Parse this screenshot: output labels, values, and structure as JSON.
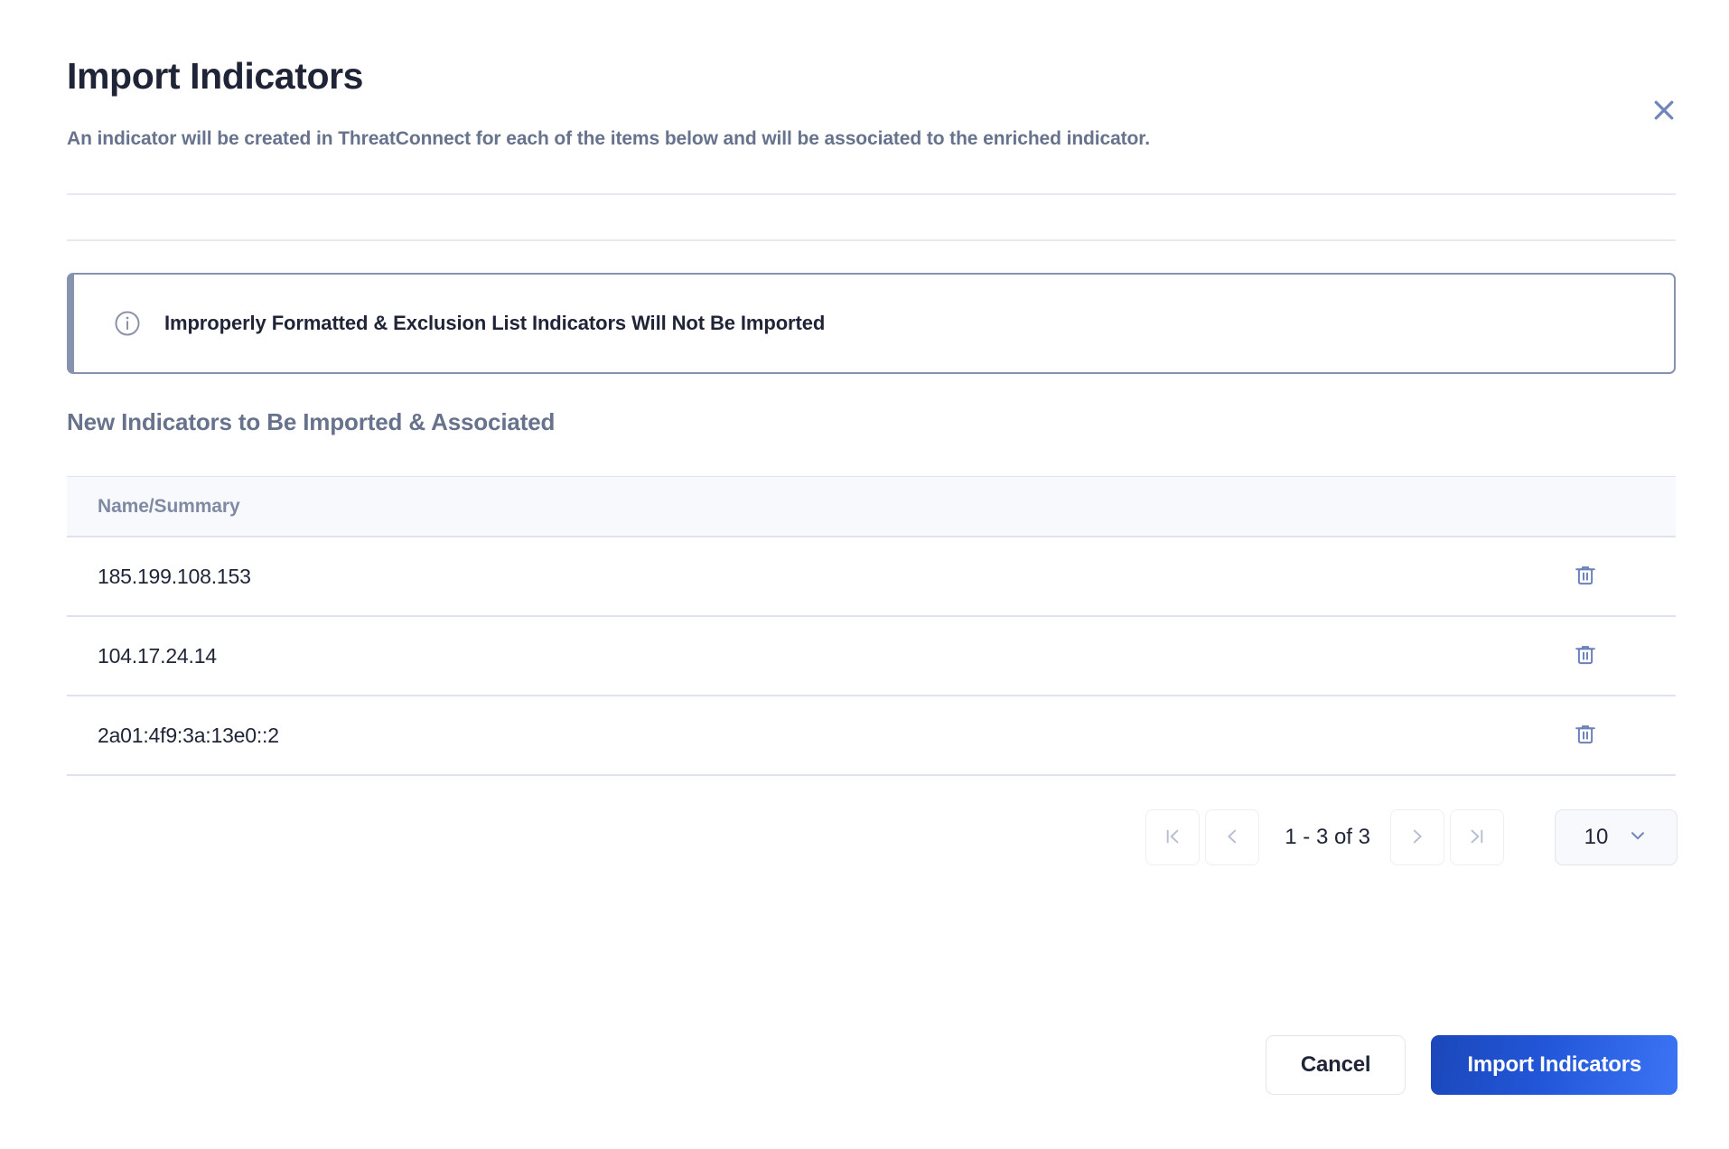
{
  "dialog": {
    "title": "Import Indicators",
    "subtitle": "An indicator will be created in ThreatConnect for each of the items below and will be associated to the enriched indicator.",
    "close_icon": "close-icon"
  },
  "banner": {
    "icon": "info-circle-icon",
    "text": "Improperly Formatted & Exclusion List Indicators Will Not Be Imported",
    "accent_color": "#8792ad"
  },
  "section": {
    "heading": "New Indicators to Be Imported & Associated"
  },
  "table": {
    "columns": [
      "Name/Summary"
    ],
    "rows": [
      {
        "name": "185.199.108.153",
        "delete_icon": "trash-icon"
      },
      {
        "name": "104.17.24.14",
        "delete_icon": "trash-icon"
      },
      {
        "name": "2a01:4f9:3a:13e0::2",
        "delete_icon": "trash-icon"
      }
    ]
  },
  "pagination": {
    "first_icon": "first-page-icon",
    "prev_icon": "chevron-left-icon",
    "range_label": "1 - 3 of 3",
    "next_icon": "chevron-right-icon",
    "last_icon": "last-page-icon",
    "page_size": "10",
    "page_size_chevron": "chevron-down-icon"
  },
  "footer": {
    "cancel_label": "Cancel",
    "import_label": "Import Indicators",
    "primary_color": "#2256d8"
  }
}
